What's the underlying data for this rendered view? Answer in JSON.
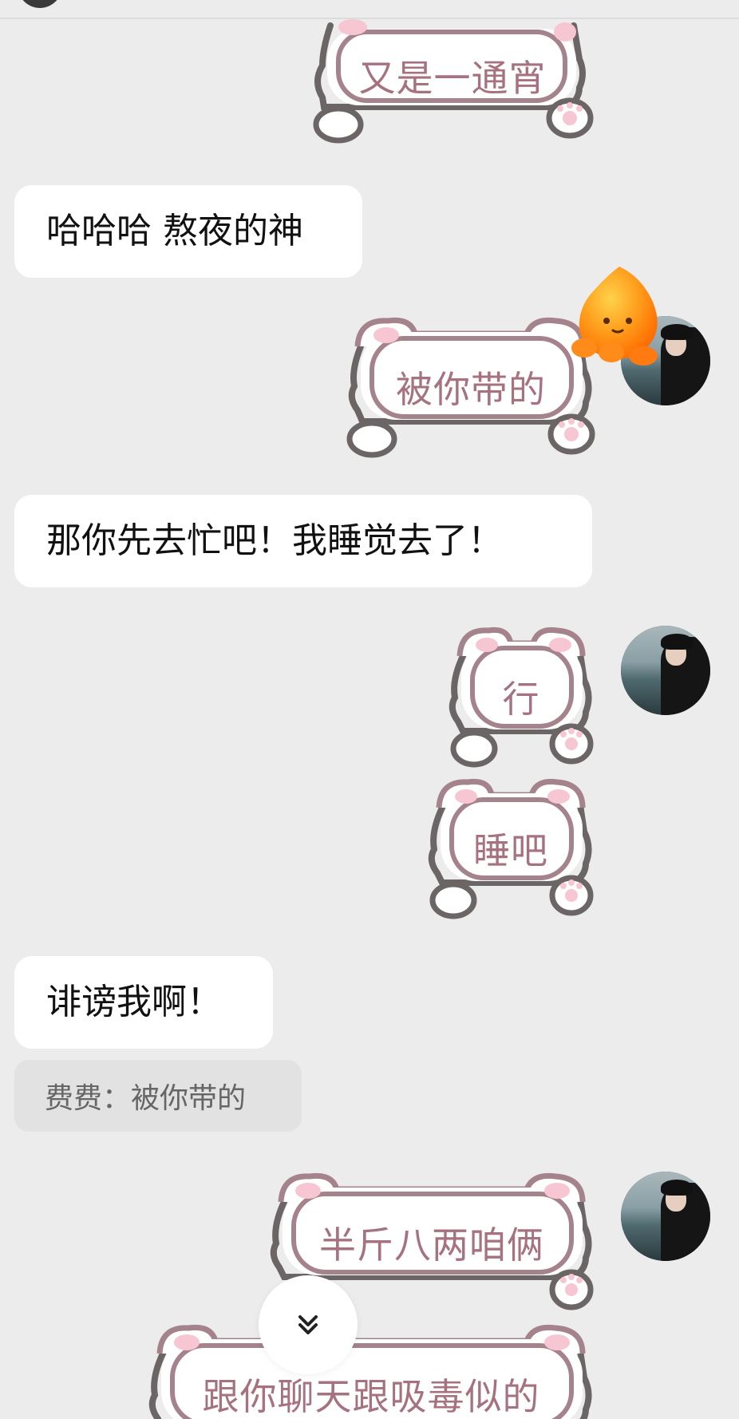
{
  "messages": {
    "m1": "又是一通宵",
    "m2": "哈哈哈 熬夜的神",
    "m3": "被你带的",
    "m4": "那你先去忙吧！我睡觉去了！",
    "m5": "行",
    "m6": "睡吧",
    "m7": "诽谤我啊！",
    "quote": "费费：被你带的",
    "m8": "半斤八两咱俩",
    "m9": "跟你聊天跟吸毒似的"
  },
  "icons": {
    "scroll_down": "double-chevron-down-icon",
    "sticker": "orange-drop-sticker"
  },
  "colors": {
    "background": "#ececec",
    "cat_text": "#a6727f",
    "cat_outline": "#6b6566",
    "cat_inner": "#a5838c",
    "pink": "#f7c6d3"
  }
}
